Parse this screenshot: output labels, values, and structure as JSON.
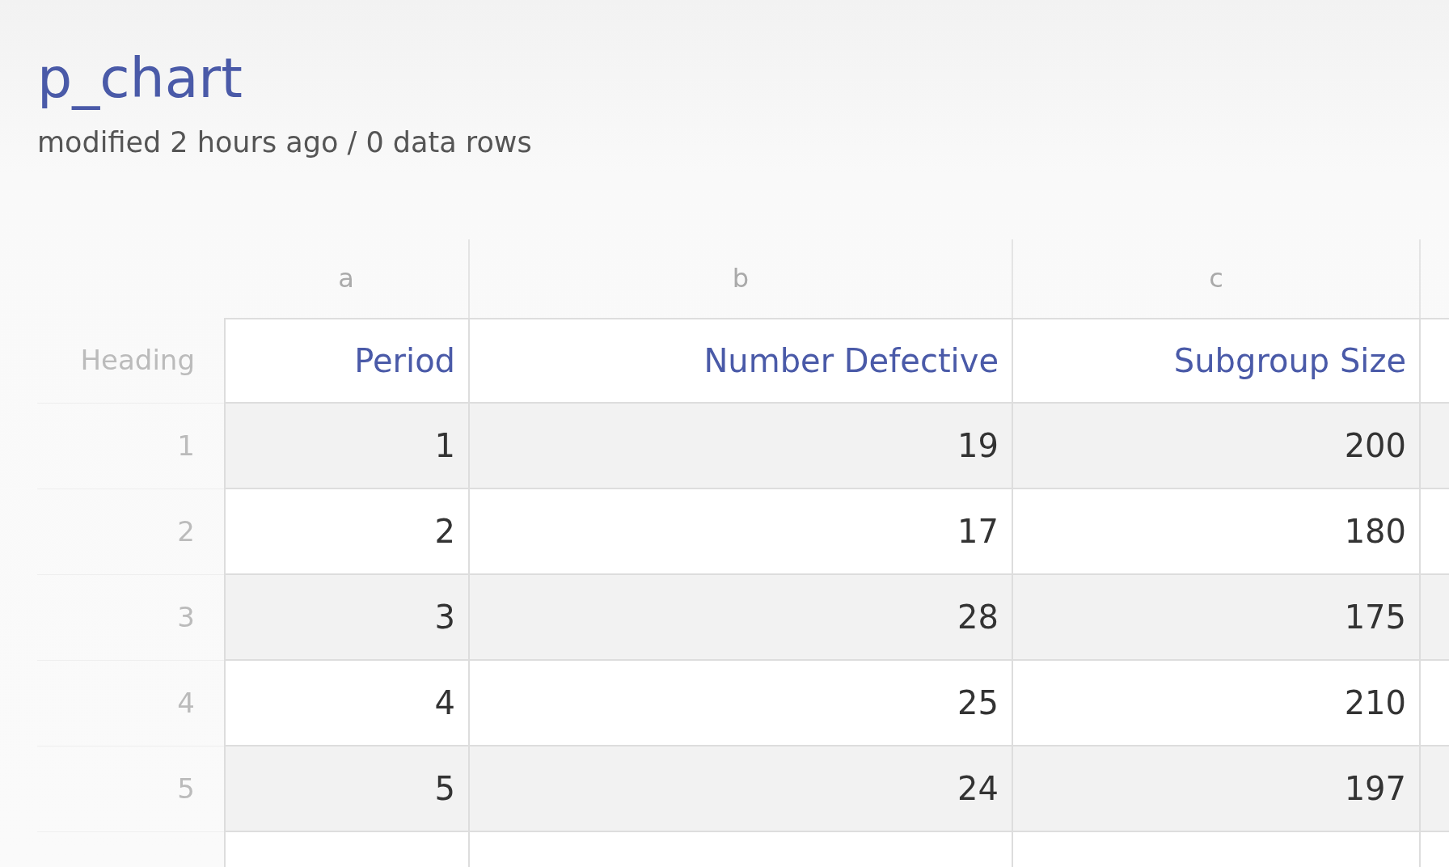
{
  "title": "p_chart",
  "subtitle": "modified 2 hours ago / 0 data rows",
  "table": {
    "column_letters": [
      "a",
      "b",
      "c"
    ],
    "heading_label": "Heading",
    "columns": [
      "Period",
      "Number Defective",
      "Subgroup Size"
    ],
    "rows": [
      {
        "number": "1",
        "cells": [
          "1",
          "19",
          "200"
        ]
      },
      {
        "number": "2",
        "cells": [
          "2",
          "17",
          "180"
        ]
      },
      {
        "number": "3",
        "cells": [
          "3",
          "28",
          "175"
        ]
      },
      {
        "number": "4",
        "cells": [
          "4",
          "25",
          "210"
        ]
      },
      {
        "number": "5",
        "cells": [
          "5",
          "24",
          "197"
        ]
      }
    ]
  }
}
